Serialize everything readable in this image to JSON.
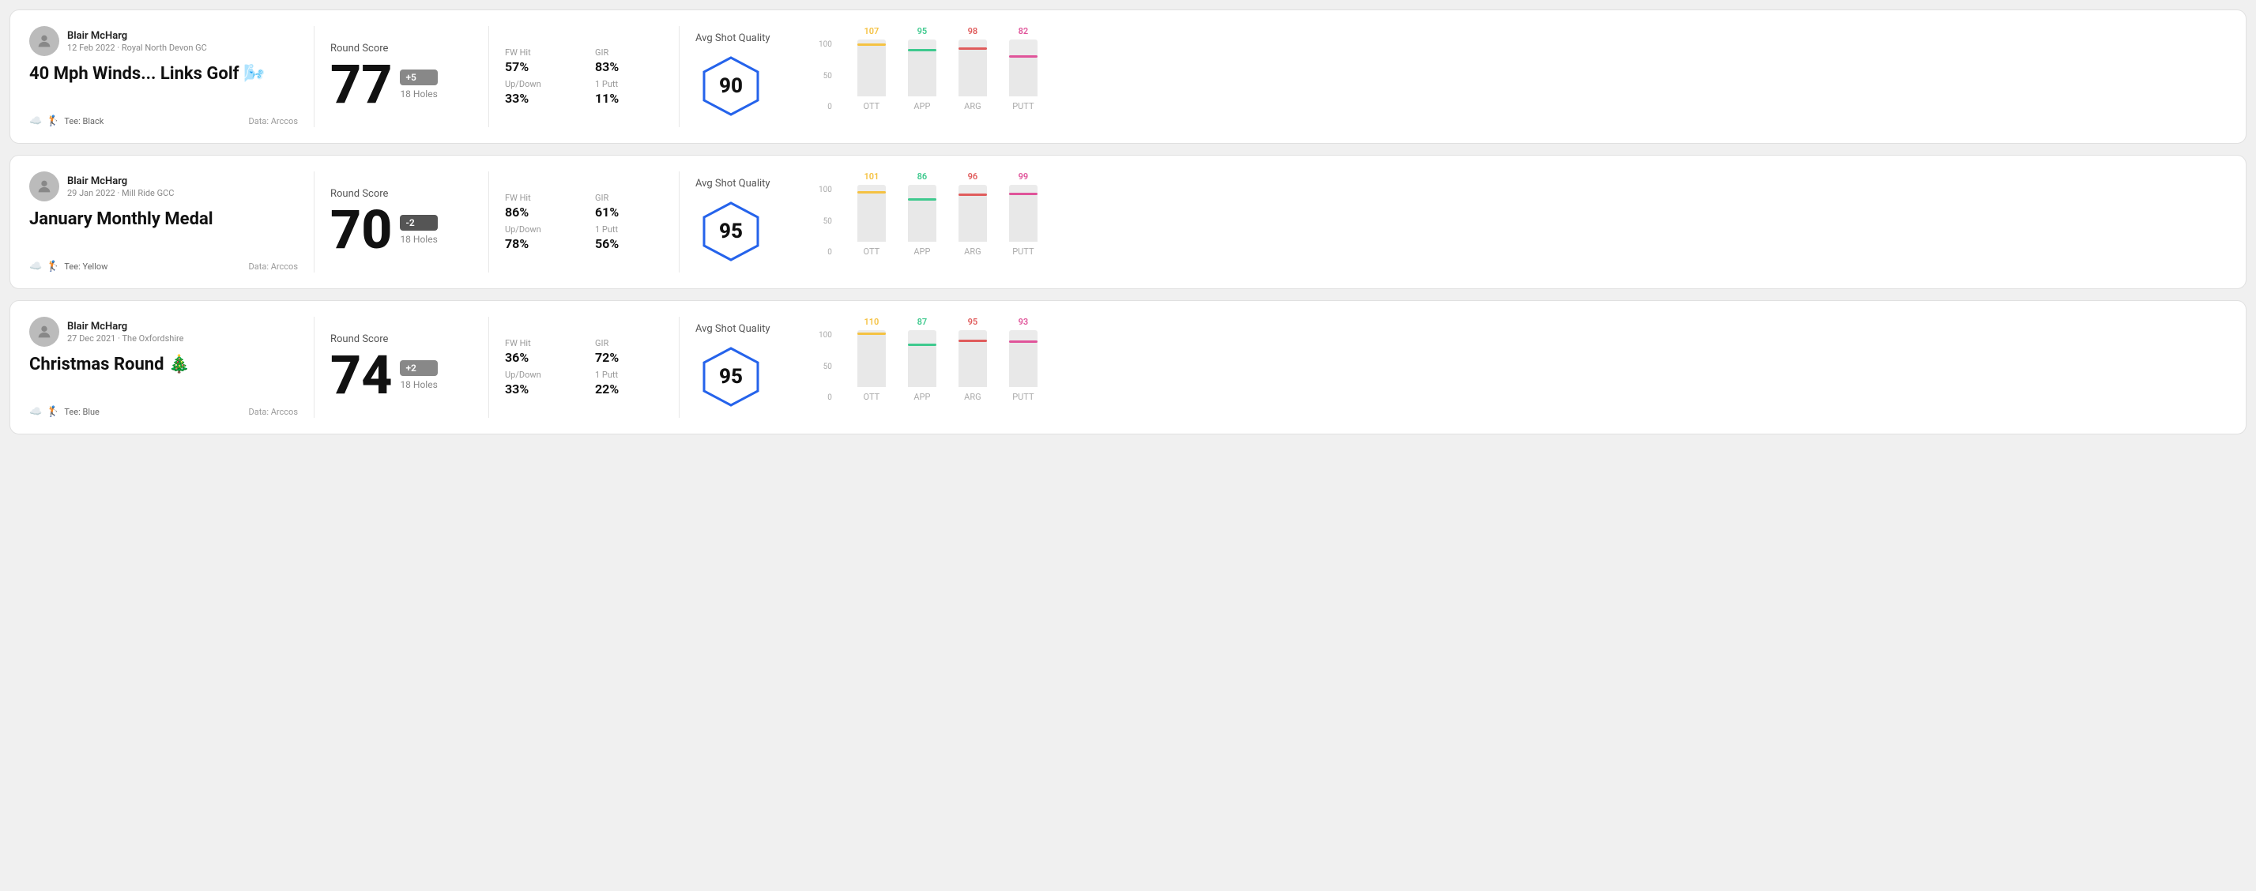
{
  "rounds": [
    {
      "id": "round1",
      "user": {
        "name": "Blair McHarg",
        "date": "12 Feb 2022 · Royal North Devon GC"
      },
      "title": "40 Mph Winds... Links Golf 🌬️",
      "tee": "Black",
      "data_source": "Data: Arccos",
      "score": {
        "value": "77",
        "modifier": "+5",
        "modifier_type": "plus",
        "holes": "18 Holes",
        "label": "Round Score"
      },
      "stats": {
        "fw_hit": "57%",
        "gir": "83%",
        "up_down": "33%",
        "one_putt": "11%"
      },
      "quality": {
        "label": "Avg Shot Quality",
        "score": "90"
      },
      "chart": {
        "bars": [
          {
            "label": "OTT",
            "value": 107,
            "color": "#f5c242"
          },
          {
            "label": "APP",
            "value": 95,
            "color": "#3ec98e"
          },
          {
            "label": "ARG",
            "value": 98,
            "color": "#e05c5c"
          },
          {
            "label": "PUTT",
            "value": 82,
            "color": "#e0549a"
          }
        ],
        "max": 100,
        "y_labels": [
          "100",
          "50",
          "0"
        ]
      }
    },
    {
      "id": "round2",
      "user": {
        "name": "Blair McHarg",
        "date": "29 Jan 2022 · Mill Ride GCC"
      },
      "title": "January Monthly Medal",
      "tee": "Yellow",
      "data_source": "Data: Arccos",
      "score": {
        "value": "70",
        "modifier": "-2",
        "modifier_type": "minus",
        "holes": "18 Holes",
        "label": "Round Score"
      },
      "stats": {
        "fw_hit": "86%",
        "gir": "61%",
        "up_down": "78%",
        "one_putt": "56%"
      },
      "quality": {
        "label": "Avg Shot Quality",
        "score": "95"
      },
      "chart": {
        "bars": [
          {
            "label": "OTT",
            "value": 101,
            "color": "#f5c242"
          },
          {
            "label": "APP",
            "value": 86,
            "color": "#3ec98e"
          },
          {
            "label": "ARG",
            "value": 96,
            "color": "#e05c5c"
          },
          {
            "label": "PUTT",
            "value": 99,
            "color": "#e0549a"
          }
        ],
        "max": 100,
        "y_labels": [
          "100",
          "50",
          "0"
        ]
      }
    },
    {
      "id": "round3",
      "user": {
        "name": "Blair McHarg",
        "date": "27 Dec 2021 · The Oxfordshire"
      },
      "title": "Christmas Round 🎄",
      "tee": "Blue",
      "data_source": "Data: Arccos",
      "score": {
        "value": "74",
        "modifier": "+2",
        "modifier_type": "plus",
        "holes": "18 Holes",
        "label": "Round Score"
      },
      "stats": {
        "fw_hit": "36%",
        "gir": "72%",
        "up_down": "33%",
        "one_putt": "22%"
      },
      "quality": {
        "label": "Avg Shot Quality",
        "score": "95"
      },
      "chart": {
        "bars": [
          {
            "label": "OTT",
            "value": 110,
            "color": "#f5c242"
          },
          {
            "label": "APP",
            "value": 87,
            "color": "#3ec98e"
          },
          {
            "label": "ARG",
            "value": 95,
            "color": "#e05c5c"
          },
          {
            "label": "PUTT",
            "value": 93,
            "color": "#e0549a"
          }
        ],
        "max": 100,
        "y_labels": [
          "100",
          "50",
          "0"
        ]
      }
    }
  ],
  "labels": {
    "fw_hit": "FW Hit",
    "gir": "GIR",
    "up_down": "Up/Down",
    "one_putt": "1 Putt"
  }
}
